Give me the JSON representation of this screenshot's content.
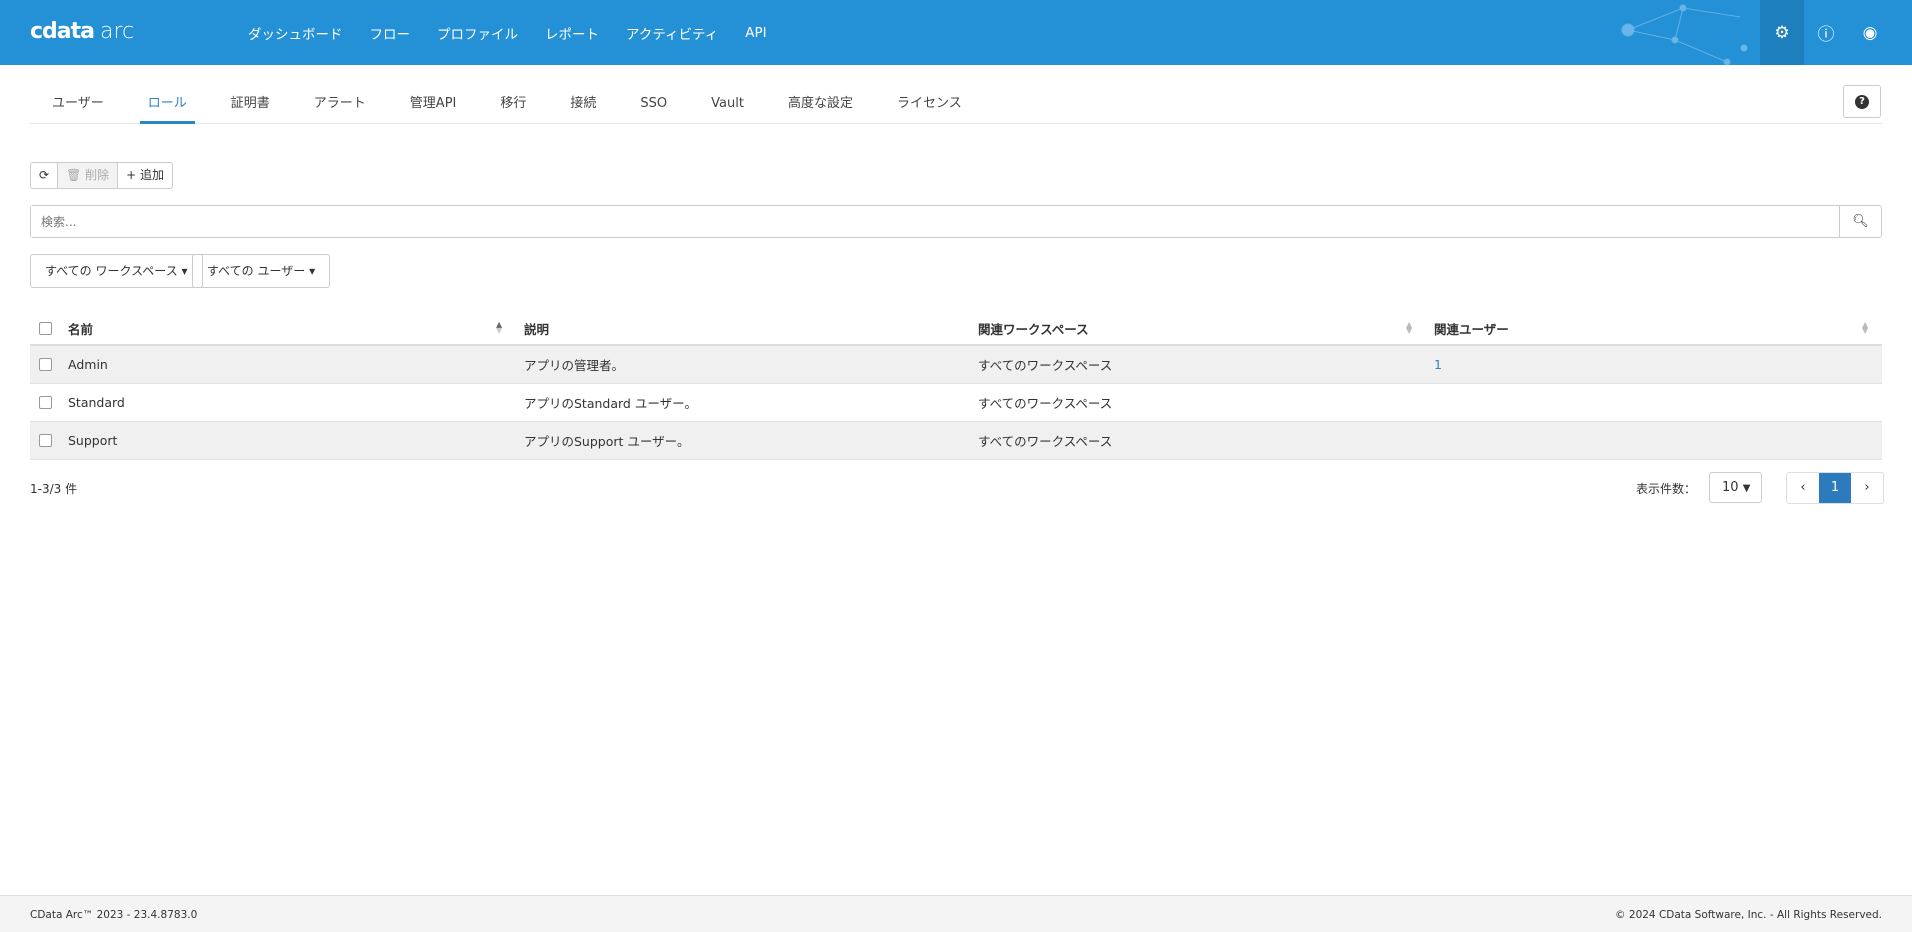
{
  "header": {
    "logo": "cdata",
    "logo_product": "arc",
    "nav": [
      "ダッシュボード",
      "フロー",
      "プロファイル",
      "レポート",
      "アクティビティ",
      "API"
    ]
  },
  "tabs": [
    "ユーザー",
    "ロール",
    "証明書",
    "アラート",
    "管理API",
    "移行",
    "接続",
    "SSO",
    "Vault",
    "高度な設定",
    "ライセンス"
  ],
  "toolbar": {
    "delete": "削除",
    "add": "追加"
  },
  "search": {
    "placeholder": "検索..."
  },
  "filters": {
    "workspace": "すべての ワークスペース",
    "user": "すべての ユーザー"
  },
  "table": {
    "headers": [
      "名前",
      "説明",
      "関連ワークスペース",
      "関連ユーザー"
    ],
    "rows": [
      {
        "name": "Admin",
        "desc": "アプリの管理者。",
        "ws": "すべてのワークスペース",
        "users": "1"
      },
      {
        "name": "Standard",
        "desc": "アプリのStandard ユーザー。",
        "ws": "すべてのワークスペース",
        "users": ""
      },
      {
        "name": "Support",
        "desc": "アプリのSupport ユーザー。",
        "ws": "すべてのワークスペース",
        "users": ""
      }
    ]
  },
  "pagination": {
    "count": "1-3/3 件",
    "per_page_label": "表示件数：",
    "per_page": "10",
    "current": "1"
  },
  "footer": {
    "left": "CData Arc™ 2023 - 23.4.8783.0",
    "right": "© 2024 CData Software, Inc. - All Rights Reserved."
  },
  "colors": {
    "header": "#2491d6",
    "accent": "#2b86c5"
  }
}
